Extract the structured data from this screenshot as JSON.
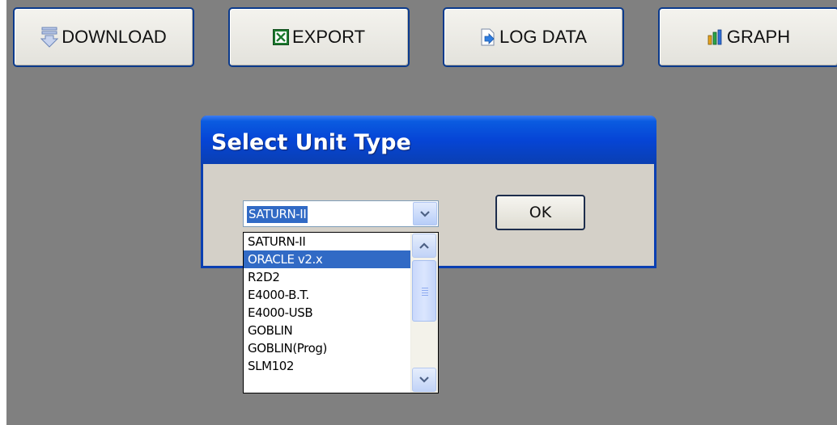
{
  "toolbar": {
    "download_label": "DOWNLOAD",
    "export_label": "EXPORT",
    "log_data_label": "LOG DATA",
    "graph_label": "GRAPH"
  },
  "dialog": {
    "title": "Select Unit Type",
    "ok_label": "OK"
  },
  "unit_select": {
    "selected_value": "SATURN-II",
    "options": [
      {
        "label": "SATURN-II"
      },
      {
        "label": "ORACLE v2.x"
      },
      {
        "label": "R2D2"
      },
      {
        "label": "E4000-B.T."
      },
      {
        "label": "E4000-USB"
      },
      {
        "label": "GOBLIN"
      },
      {
        "label": "GOBLIN(Prog)"
      },
      {
        "label": "SLM102"
      }
    ],
    "highlighted_option": "ORACLE v2.x"
  },
  "icons": {
    "download": "download-arrow-icon",
    "export": "excel-icon",
    "log_data": "document-arrow-icon",
    "graph": "bar-chart-icon",
    "dropdown": "chevron-down-icon",
    "scroll_up": "chevron-up-icon",
    "scroll_down": "chevron-down-icon"
  },
  "colors": {
    "desktop_bg": "#808080",
    "title_bar": "#0645d6",
    "selection": "#316ac5",
    "dialog_face": "#d4d0c8"
  }
}
